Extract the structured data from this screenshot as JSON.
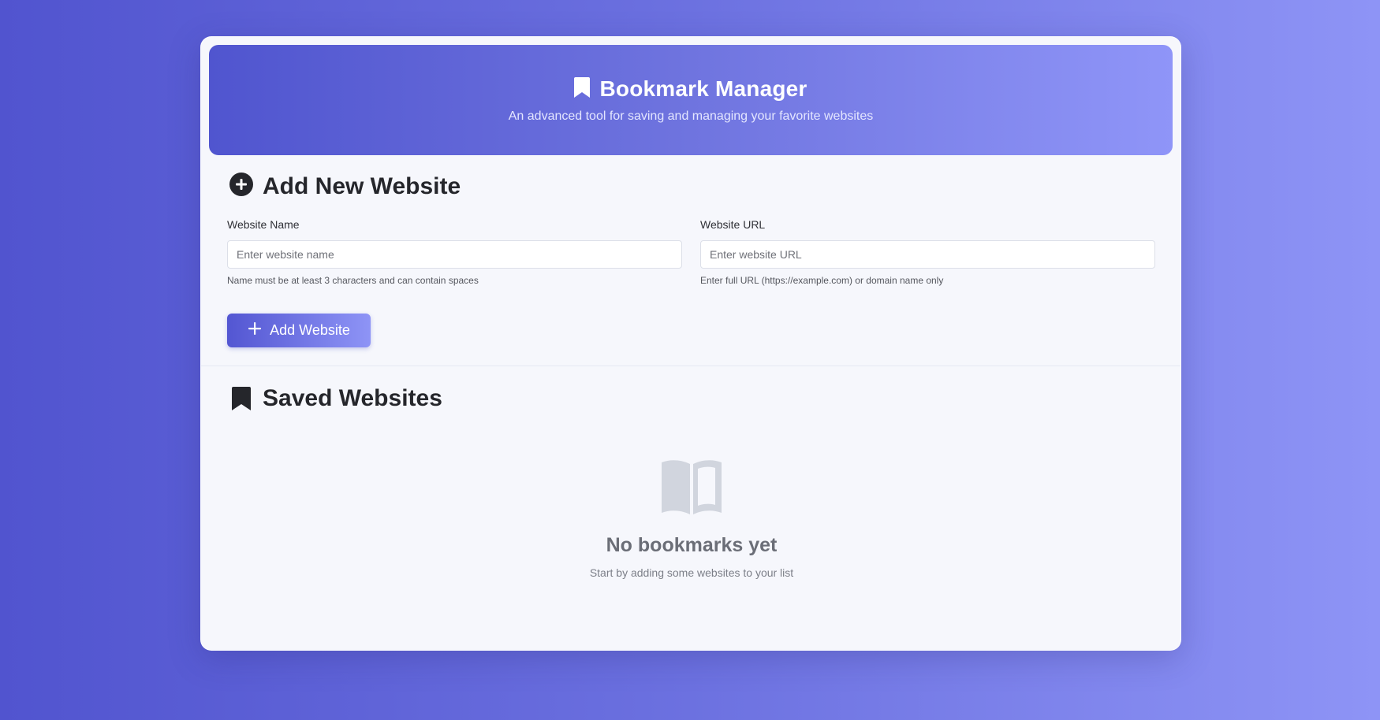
{
  "header": {
    "title": "Bookmark Manager",
    "subtitle": "An advanced tool for saving and managing your favorite websites",
    "icon": "bookmark-icon"
  },
  "add_section": {
    "title": "Add New Website",
    "icon": "plus-circle-icon",
    "name_field": {
      "label": "Website Name",
      "placeholder": "Enter website name",
      "value": "",
      "hint": "Name must be at least 3 characters and can contain spaces"
    },
    "url_field": {
      "label": "Website URL",
      "placeholder": "Enter website URL",
      "value": "",
      "hint": "Enter full URL (https://example.com) or domain name only"
    },
    "add_button": {
      "label": "Add Website",
      "icon": "plus-icon"
    }
  },
  "saved_section": {
    "title": "Saved Websites",
    "icon": "bookmark-icon",
    "empty_state": {
      "icon": "open-book-icon",
      "title": "No bookmarks yet",
      "subtitle": "Start by adding some websites to your list"
    }
  },
  "colors": {
    "accent_start": "#5055cf",
    "accent_end": "#8f95f8",
    "card_bg": "#f6f7fc",
    "heading": "#25262b",
    "empty_icon": "#d1d5de"
  }
}
